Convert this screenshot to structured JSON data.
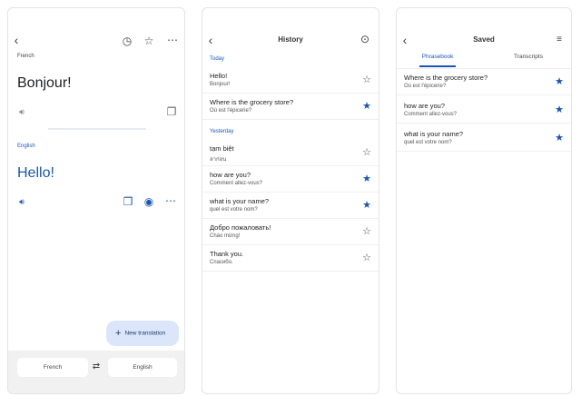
{
  "translate": {
    "source_lang": "French",
    "source_text": "Bonjour!",
    "target_lang": "English",
    "target_text": "Hello!",
    "fab_label": "New translation",
    "bottom_source": "French",
    "bottom_target": "English"
  },
  "history": {
    "title": "History",
    "sections": [
      {
        "label": "Today",
        "items": [
          {
            "text": "Hello!",
            "sub": "Bonjour!",
            "starred": false
          },
          {
            "text": "Where is the grocery store?",
            "sub": "Où est l'épicerie?",
            "starred": true
          }
        ]
      },
      {
        "label": "Yesterday",
        "items": [
          {
            "text": "tạm biệt",
            "sub": "ลาก่อน",
            "starred": false
          },
          {
            "text": "how are you?",
            "sub": "Comment allez-vous?",
            "starred": true
          },
          {
            "text": "what is your name?",
            "sub": "quel est votre nom?",
            "starred": true
          },
          {
            "text": "Добро пожаловать!",
            "sub": "Chào mừng!",
            "starred": false
          },
          {
            "text": "Thank you.",
            "sub": "Спасибо.",
            "starred": false
          }
        ]
      }
    ]
  },
  "saved": {
    "title": "Saved",
    "tabs": [
      "Phrasebook",
      "Transcripts"
    ],
    "items": [
      {
        "text": "Where is the grocery store?",
        "sub": "Où est l'épicerie?"
      },
      {
        "text": "how are you?",
        "sub": "Comment allez-vous?"
      },
      {
        "text": "what is your name?",
        "sub": "quel est votre nom?"
      }
    ]
  },
  "colors": {
    "accent": "#1a56b8",
    "fab": "#dbe6fb"
  }
}
